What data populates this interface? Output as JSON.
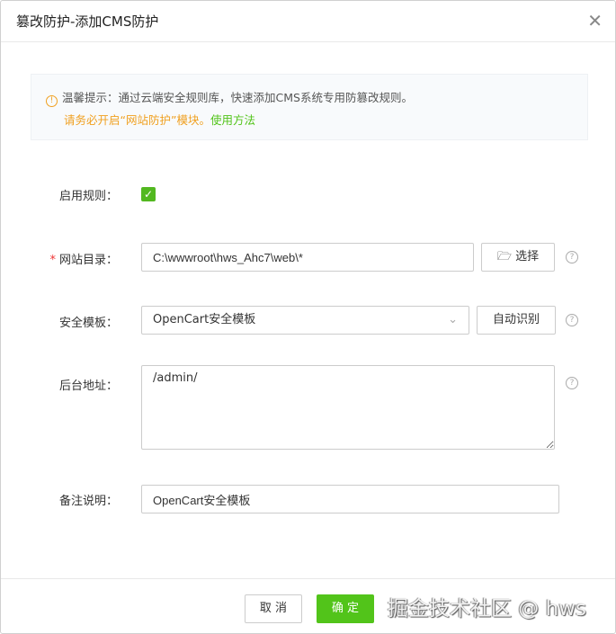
{
  "title": "篡改防护-添加CMS防护",
  "tip": {
    "line1": "温馨提示：通过云端安全规则库，快速添加CMS系统专用防篡改规则。",
    "line2": "请务必开启“网站防护”模块。",
    "link": "使用方法"
  },
  "form": {
    "enable_label": "启用规则：",
    "enabled": true,
    "dir_label": "网站目录：",
    "dir_value": "C:\\wwwroot\\hws_Ahc7\\web\\*",
    "select_btn": "选择",
    "template_label": "安全模板：",
    "template_value": "OpenCart安全模板",
    "auto_btn": "自动识别",
    "admin_label": "后台地址：",
    "admin_value": "/admin/",
    "note_label": "备注说明：",
    "note_value": "OpenCart安全模板"
  },
  "footer": {
    "cancel": "取 消",
    "ok": "确 定"
  },
  "watermark": "掘金技术社区 @ hws"
}
